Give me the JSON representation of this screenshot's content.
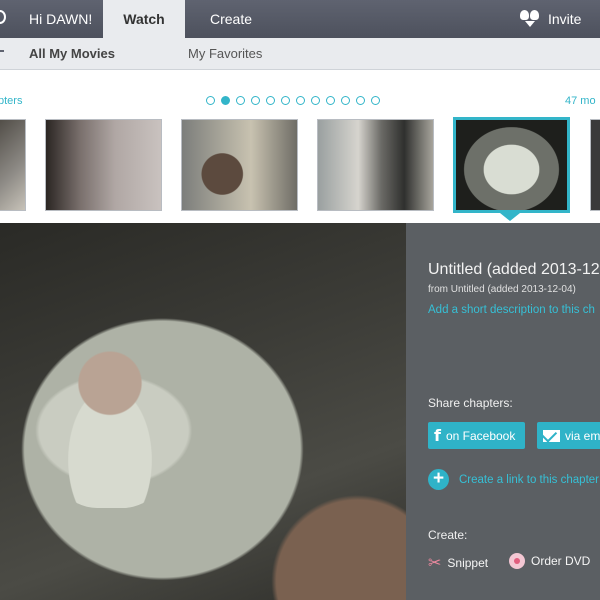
{
  "topbar": {
    "greeting": "Hi DAWN!",
    "tabs": [
      {
        "label": "Watch",
        "active": true
      },
      {
        "label": "Create",
        "active": false
      }
    ],
    "invite_label": "Invite",
    "invite_icon": "people-icon"
  },
  "subnav": {
    "tabs": [
      {
        "label": "All My Movies",
        "active": true
      },
      {
        "label": "My Favorites",
        "active": false
      }
    ]
  },
  "chapter_strip": {
    "left_link": "pters",
    "right_link": "47 mo",
    "page_dots_total": 12,
    "page_dot_active_index": 1,
    "selected_thumbnail_index": 4,
    "accent_color": "#33b5c9"
  },
  "panel": {
    "title": "Untitled (added 2013-12",
    "from": "from Untitled (added 2013-12-04)",
    "description_link": "Add a short description to this ch",
    "share_heading": "Share chapters:",
    "facebook_button": "on Facebook",
    "email_button": "via em",
    "create_link": "Create a link to this chapter",
    "create_heading": "Create:",
    "snippet_label": "Snippet",
    "dvd_label": "Order DVD",
    "background_color": "#5b5f63"
  }
}
